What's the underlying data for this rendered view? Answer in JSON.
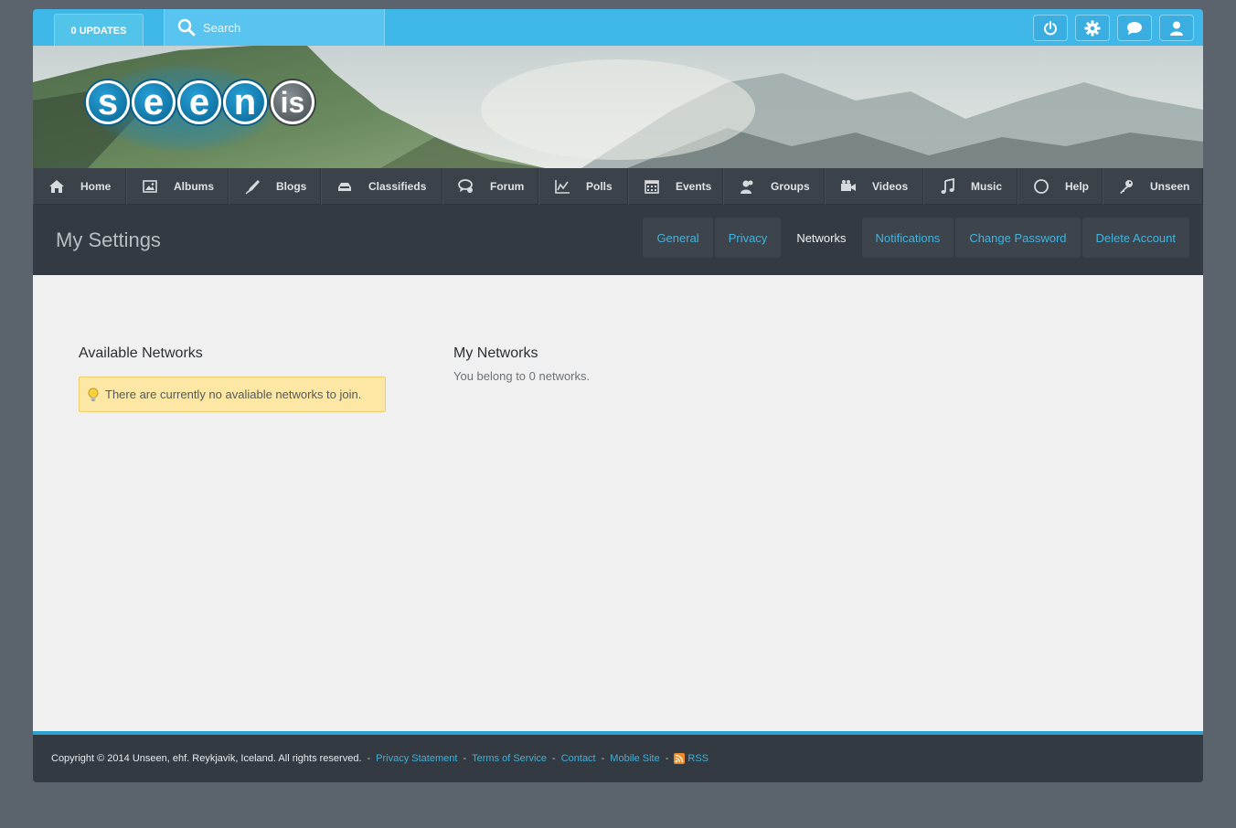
{
  "topbar": {
    "updates_label": "0 UPDATES",
    "search_placeholder": "Search",
    "icons": [
      "power-icon",
      "gear-icon",
      "chat-icon",
      "user-icon"
    ]
  },
  "logo": {
    "letters": [
      "s",
      "e",
      "e",
      "n",
      "is"
    ]
  },
  "nav": [
    {
      "label": "Home",
      "icon": "home-icon"
    },
    {
      "label": "Albums",
      "icon": "image-icon"
    },
    {
      "label": "Blogs",
      "icon": "pen-icon"
    },
    {
      "label": "Classifieds",
      "icon": "tray-icon"
    },
    {
      "label": "Forum",
      "icon": "speech-bubble-icon"
    },
    {
      "label": "Polls",
      "icon": "line-chart-icon"
    },
    {
      "label": "Events",
      "icon": "calendar-icon"
    },
    {
      "label": "Groups",
      "icon": "users-icon"
    },
    {
      "label": "Videos",
      "icon": "video-camera-icon"
    },
    {
      "label": "Music",
      "icon": "music-note-icon"
    },
    {
      "label": "Help",
      "icon": "circle-icon"
    },
    {
      "label": "Unseen",
      "icon": "key-icon"
    }
  ],
  "settings": {
    "title": "My Settings",
    "tabs": [
      {
        "label": "General",
        "active": false
      },
      {
        "label": "Privacy",
        "active": false
      },
      {
        "label": "Networks",
        "active": true
      },
      {
        "label": "Notifications",
        "active": false
      },
      {
        "label": "Change Password",
        "active": false
      },
      {
        "label": "Delete Account",
        "active": false
      }
    ]
  },
  "available": {
    "title": "Available Networks",
    "notice": "There are currently no avaliable networks to join."
  },
  "mine": {
    "title": "My Networks",
    "text": "You belong to 0 networks."
  },
  "footer": {
    "copyright": "Copyright © 2014 Unseen, ehf. Reykjavik, Iceland. All rights reserved.",
    "privacy": "Privacy Statement",
    "terms": "Terms of Service",
    "contact": "Contact",
    "mobile": "Mobile Site",
    "rss": "RSS"
  },
  "colors": {
    "accent": "#3fb8e9",
    "dark": "#343a41",
    "link": "#42b4df",
    "notice": "#fce7a4"
  }
}
